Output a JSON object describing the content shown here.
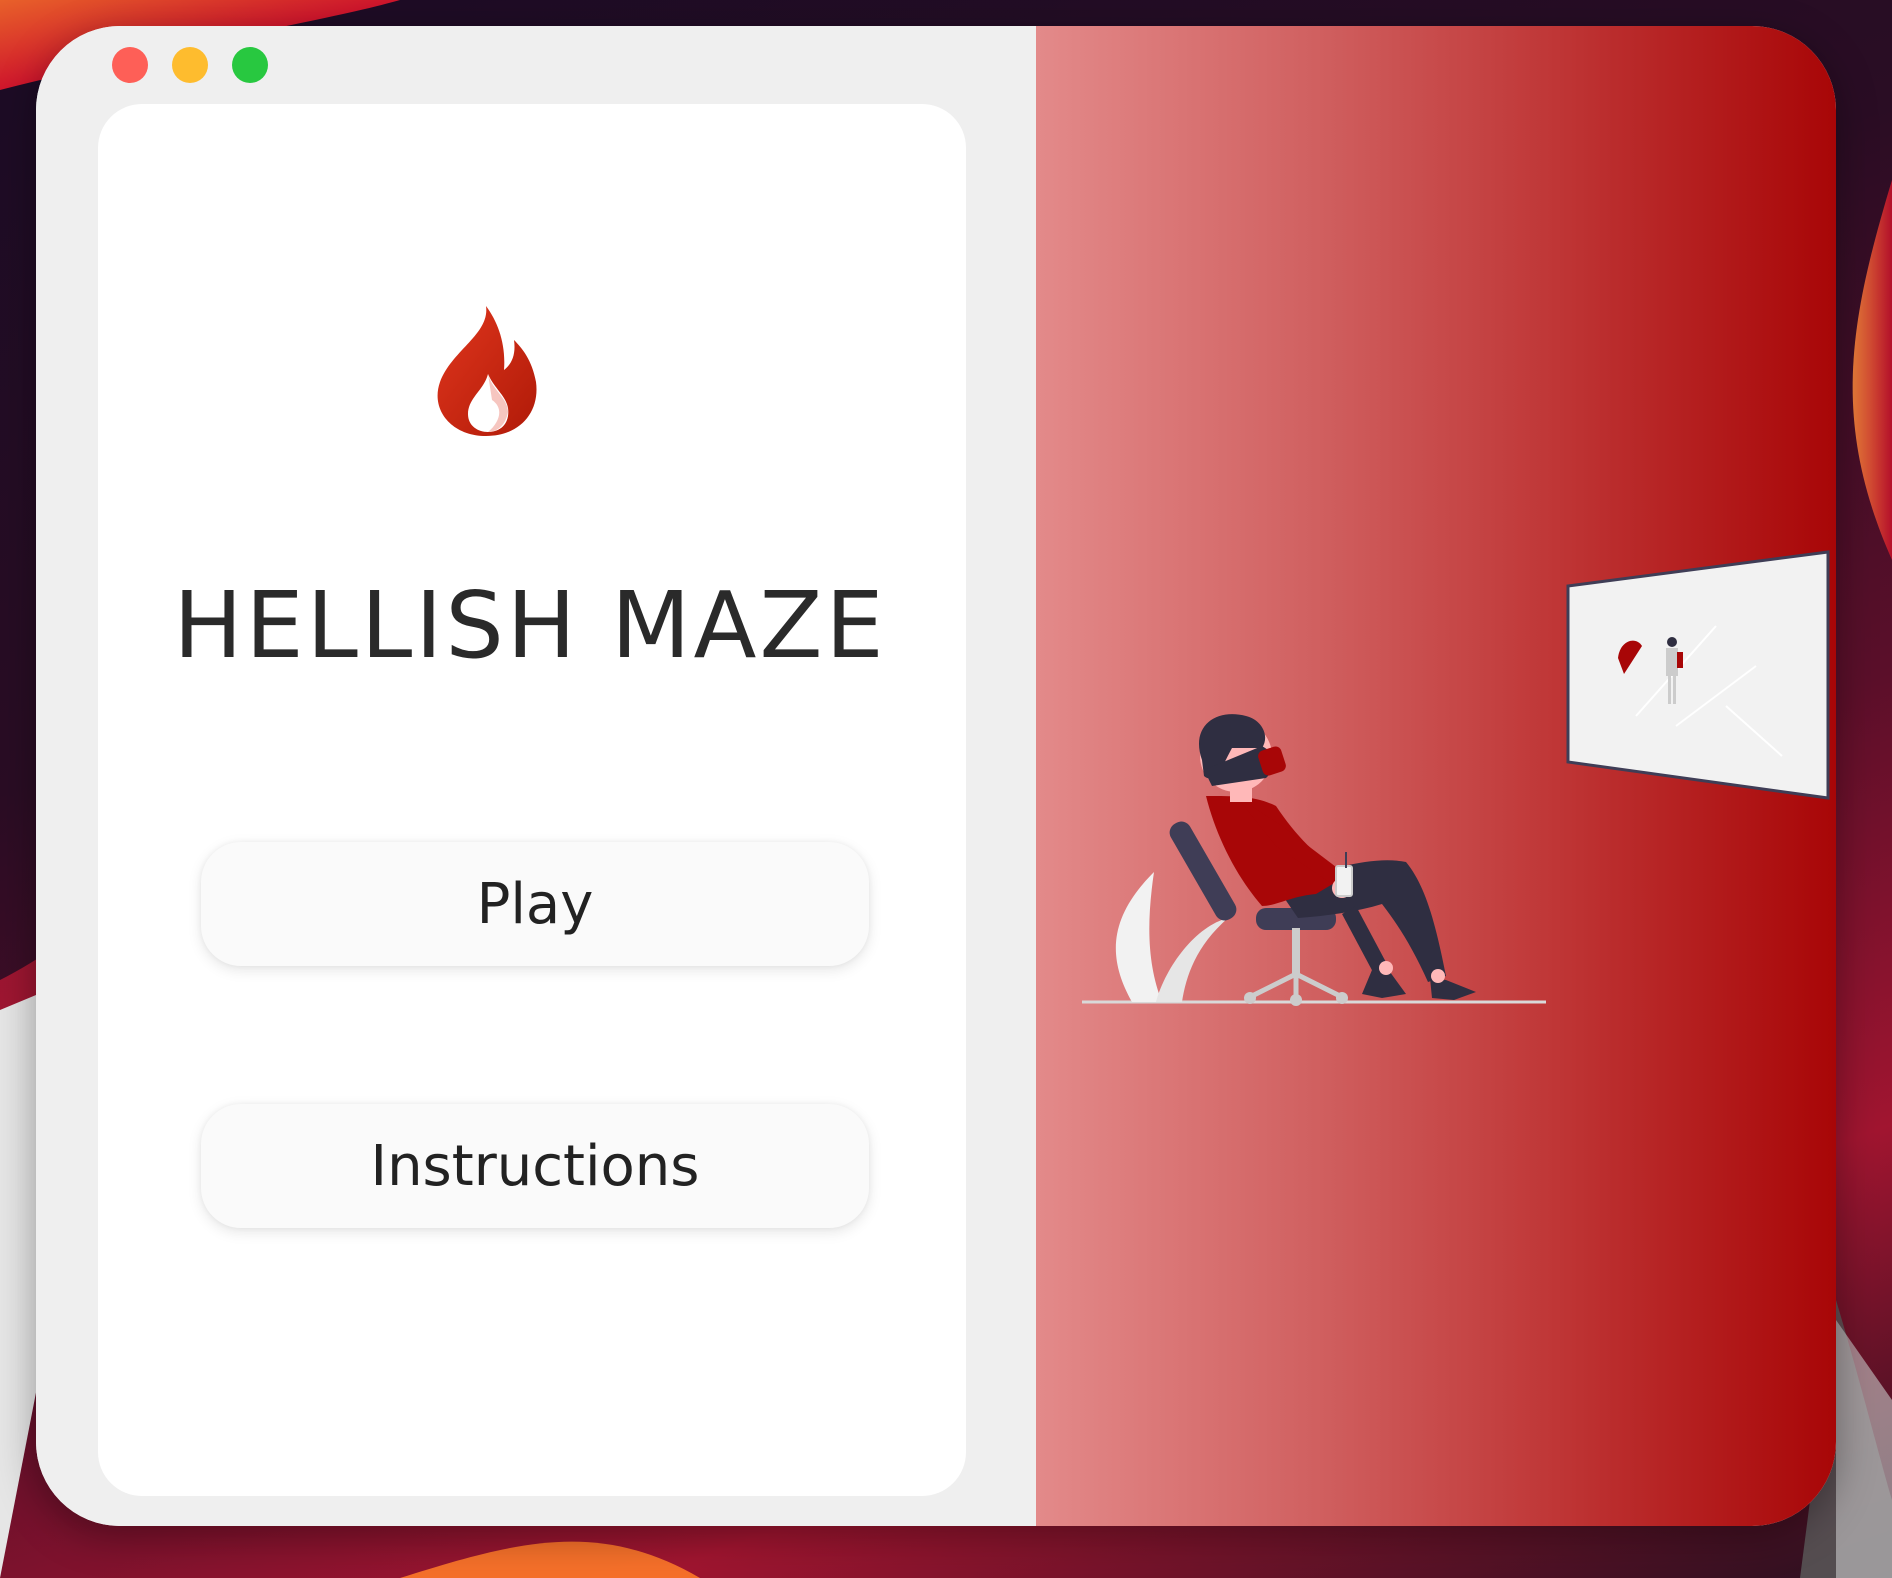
{
  "game": {
    "title": "HELLISH MAZE",
    "logo_icon": "flame-icon"
  },
  "menu": {
    "play_label": "Play",
    "instructions_label": "Instructions"
  },
  "window_controls": [
    "close",
    "minimize",
    "zoom"
  ],
  "colors": {
    "accent": "#a80607",
    "gradient_start": "#e38a8a",
    "card_background": "#ffffff",
    "window_background": "#efefef",
    "text": "#2a2a2a"
  },
  "illustration": "person-with-vr-headset-icon"
}
